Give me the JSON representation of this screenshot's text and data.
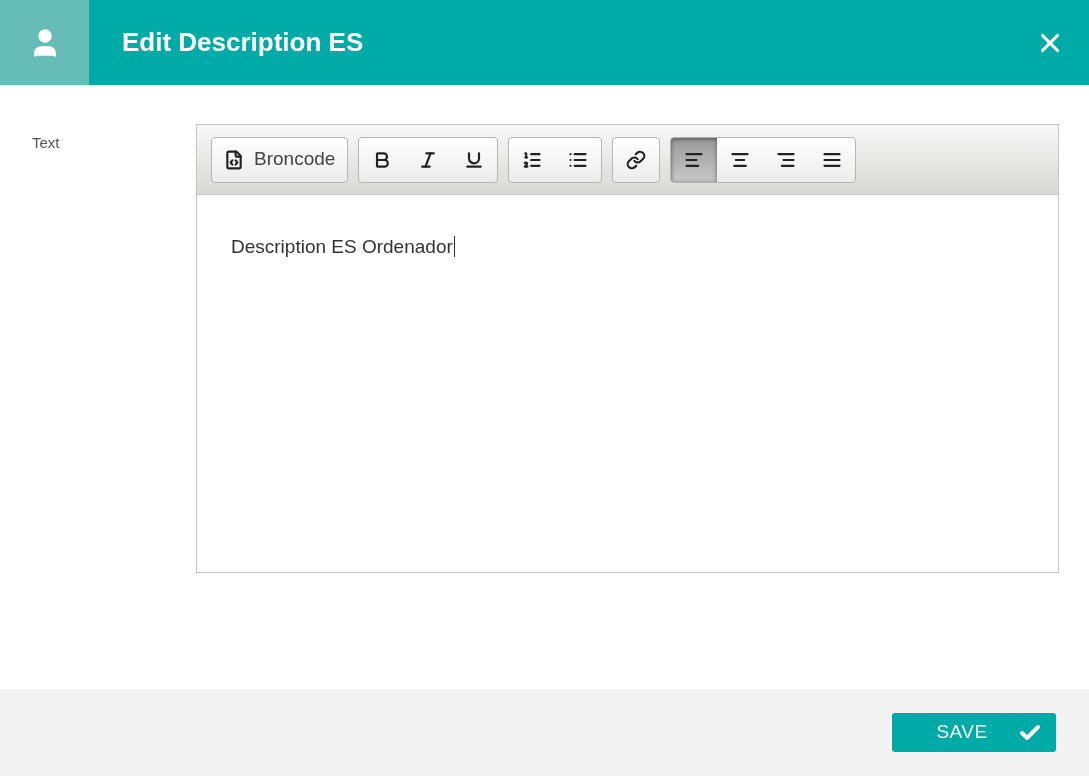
{
  "header": {
    "title": "Edit Description ES"
  },
  "field": {
    "label": "Text"
  },
  "toolbar": {
    "groups": [
      [
        {
          "kind": "source",
          "label": "Broncode",
          "selected": false
        }
      ],
      [
        {
          "kind": "bold",
          "selected": false
        },
        {
          "kind": "italic",
          "selected": false
        },
        {
          "kind": "underline",
          "selected": false
        }
      ],
      [
        {
          "kind": "ordered-list",
          "selected": false
        },
        {
          "kind": "bullet-list",
          "selected": false
        }
      ],
      [
        {
          "kind": "link",
          "selected": false
        }
      ],
      [
        {
          "kind": "align-left",
          "selected": true
        },
        {
          "kind": "align-center",
          "selected": false
        },
        {
          "kind": "align-right",
          "selected": false
        },
        {
          "kind": "justify",
          "selected": false
        }
      ]
    ]
  },
  "editor": {
    "value": "Description ES Ordenador"
  },
  "footer": {
    "save_label": "SAVE"
  }
}
